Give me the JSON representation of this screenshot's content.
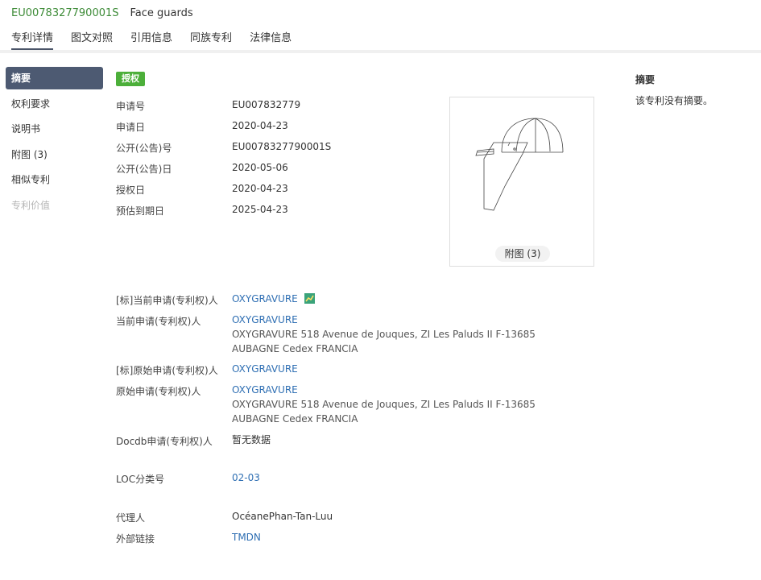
{
  "header": {
    "publication_number": "EU0078327790001S",
    "title": "Face guards",
    "tabs": [
      "专利详情",
      "图文对照",
      "引用信息",
      "同族专利",
      "法律信息"
    ]
  },
  "sidebar": {
    "items": [
      {
        "label": "摘要"
      },
      {
        "label": "权利要求"
      },
      {
        "label": "说明书"
      },
      {
        "label": "附图 (3)"
      },
      {
        "label": "相似专利"
      },
      {
        "label": "专利价值"
      }
    ]
  },
  "status_badge": "授权",
  "fields": {
    "app_no_label": "申请号",
    "app_no": "EU007832779",
    "app_date_label": "申请日",
    "app_date": "2020-04-23",
    "pub_no_label": "公开(公告)号",
    "pub_no": "EU0078327790001S",
    "pub_date_label": "公开(公告)日",
    "pub_date": "2020-05-06",
    "grant_date_label": "授权日",
    "grant_date": "2020-04-23",
    "expiry_label": "预估到期日",
    "expiry": "2025-04-23",
    "std_cur_label": "[标]当前申请(专利权)人",
    "std_cur": "OXYGRAVURE",
    "cur_label": "当前申请(专利权)人",
    "cur": "OXYGRAVURE",
    "cur_addr": "OXYGRAVURE 518 Avenue de Jouques, ZI Les Paluds II F-13685 AUBAGNE Cedex FRANCIA",
    "std_orig_label": "[标]原始申请(专利权)人",
    "std_orig": "OXYGRAVURE",
    "orig_label": "原始申请(专利权)人",
    "orig": "OXYGRAVURE",
    "orig_addr": "OXYGRAVURE 518 Avenue de Jouques, ZI Les Paluds II F-13685 AUBAGNE Cedex FRANCIA",
    "docdb_label": "Docdb申请(专利权)人",
    "docdb": "暂无数据",
    "loc_label": "LOC分类号",
    "loc": "02-03",
    "agent_label": "代理人",
    "agent": "OcéanePhan-Tan-Luu",
    "ext_link_label": "外部链接",
    "ext_link": "TMDN"
  },
  "figure": {
    "button_label": "附图 (3)"
  },
  "abstract": {
    "title": "摘要",
    "text": "该专利没有摘要。"
  },
  "colors": {
    "accent_green": "#3d8b37",
    "sidebar_active": "#4d5a72",
    "link": "#2f6fb3",
    "badge": "#4caf3a"
  }
}
